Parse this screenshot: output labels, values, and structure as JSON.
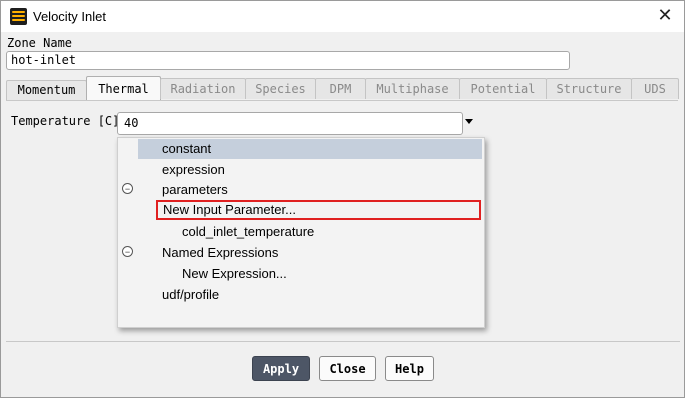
{
  "window": {
    "title": "Velocity Inlet",
    "close_glyph": "✕",
    "icon": "fluent-app-icon"
  },
  "zone": {
    "label": "Zone Name",
    "value": "hot-inlet"
  },
  "tabs": [
    {
      "label": "Momentum",
      "state": "enabled"
    },
    {
      "label": "Thermal",
      "state": "active"
    },
    {
      "label": "Radiation",
      "state": "disabled"
    },
    {
      "label": "Species",
      "state": "disabled"
    },
    {
      "label": "DPM",
      "state": "disabled"
    },
    {
      "label": "Multiphase",
      "state": "disabled"
    },
    {
      "label": "Potential",
      "state": "disabled"
    },
    {
      "label": "Structure",
      "state": "disabled"
    },
    {
      "label": "UDS",
      "state": "disabled"
    }
  ],
  "thermal": {
    "temperature_label": "Temperature [C]",
    "temperature_value": "40"
  },
  "dropdown": {
    "items": [
      {
        "label": "constant",
        "selected": true
      },
      {
        "label": "expression"
      },
      {
        "label": "parameters",
        "collapsible": true
      },
      {
        "label": "New Input Parameter...",
        "highlighted": true
      },
      {
        "label": "cold_inlet_temperature"
      },
      {
        "label": "Named Expressions",
        "collapsible": true
      },
      {
        "label": "New Expression..."
      },
      {
        "label": "udf/profile"
      }
    ],
    "collapse_glyph": "−"
  },
  "buttons": {
    "apply": "Apply",
    "close": "Close",
    "help": "Help"
  },
  "colors": {
    "primary_button": "#4d5666",
    "selected_item": "#c5cfdc",
    "highlight_border": "#e02020"
  }
}
